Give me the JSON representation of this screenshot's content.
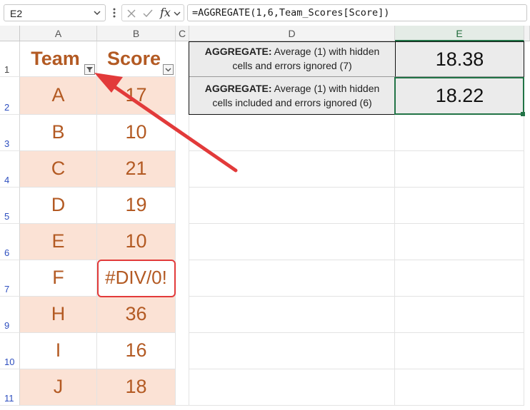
{
  "formula_bar": {
    "name_box": "E2",
    "fx_label": "fx",
    "formula": "=AGGREGATE(1,6,Team_Scores[Score])"
  },
  "columns": [
    "A",
    "B",
    "C",
    "D",
    "E"
  ],
  "rows": [
    "1",
    "2",
    "3",
    "4",
    "5",
    "6",
    "7",
    "9",
    "10",
    "11"
  ],
  "table": {
    "headers": {
      "team": "Team",
      "score": "Score"
    },
    "rows": [
      {
        "team": "A",
        "score": "17"
      },
      {
        "team": "B",
        "score": "10"
      },
      {
        "team": "C",
        "score": "21"
      },
      {
        "team": "D",
        "score": "19"
      },
      {
        "team": "E",
        "score": "10"
      },
      {
        "team": "F",
        "score": "#DIV/0!"
      },
      {
        "team": "H",
        "score": "36"
      },
      {
        "team": "I",
        "score": "16"
      },
      {
        "team": "J",
        "score": "18"
      }
    ]
  },
  "results": [
    {
      "label_bold": "AGGREGATE:",
      "label_line1": " Average (1) with hidden",
      "label_line2": "cells and errors ignored (7)",
      "value": "18.38"
    },
    {
      "label_bold": "AGGREGATE:",
      "label_line1": " Average (1) with hidden",
      "label_line2": "cells included and errors ignored (6)",
      "value": "18.22"
    }
  ],
  "colors": {
    "band": "#fbe2d5",
    "table_text": "#b35a23",
    "selection": "#217346",
    "annotation": "#e23a3a"
  }
}
